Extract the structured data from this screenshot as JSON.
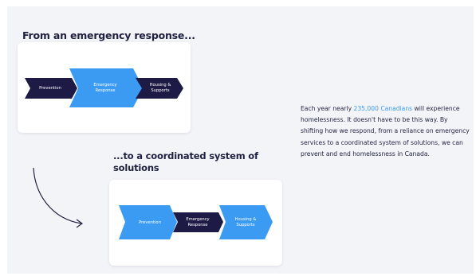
{
  "heading_emergency": "From an emergency response...",
  "heading_coordinated": "...to a coordinated system of solutions",
  "diagram_emergency": {
    "steps": [
      {
        "label": "Prevention",
        "color": "#1d1b45"
      },
      {
        "label": "Emergency\nResponse",
        "color": "#3b9bf2"
      },
      {
        "label": "Housing &\nSupports",
        "color": "#1d1b45"
      }
    ]
  },
  "diagram_coordinated": {
    "steps": [
      {
        "label": "Prevention",
        "color": "#3b9bf2"
      },
      {
        "label": "Emergency\nResponse",
        "color": "#1d1b45"
      },
      {
        "label": "Housing &\nSupports",
        "color": "#3b9bf2"
      }
    ]
  },
  "paragraph": {
    "before": "Each year nearly ",
    "highlight": "235,000 Canadians",
    "after": " will experience homelessness. It doesn't have to be this way. By shifting how we respond, from a reliance on emergency services to a coordinated system of solutions, we can prevent and end homelessness in Canada."
  },
  "colors": {
    "dark": "#1d1b45",
    "accent": "#3b9bf2",
    "panel": "#f3f4f8"
  },
  "icons": {
    "transition_arrow": "curved-arrow-icon"
  }
}
